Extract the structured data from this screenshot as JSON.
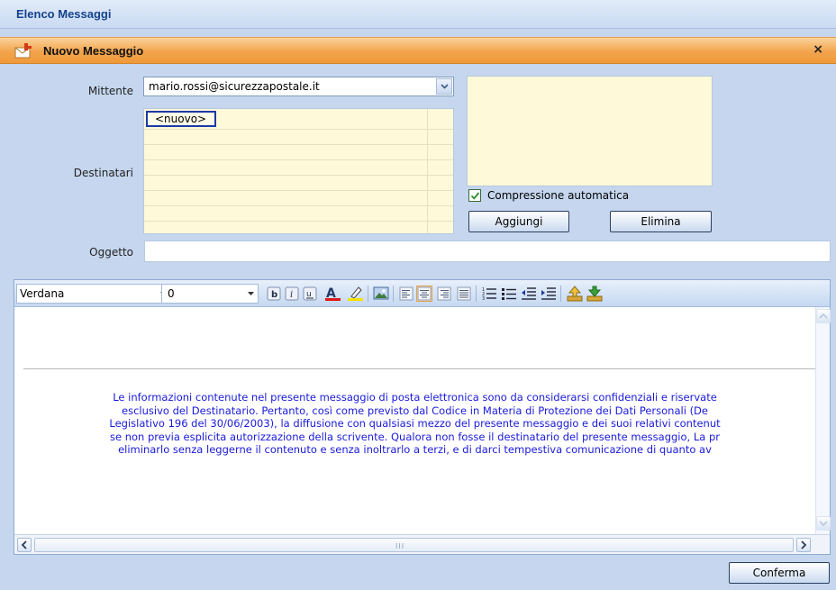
{
  "window": {
    "title": "Elenco Messaggi"
  },
  "dialog": {
    "title": "Nuovo Messaggio",
    "close_symbol": "×"
  },
  "form": {
    "sender_label": "Mittente",
    "sender_value": "mario.rossi@sicurezzapostale.it",
    "recipients_label": "Destinatari",
    "new_recipient": "<nuovo>",
    "compression_checked": true,
    "compression_label": "Compressione automatica",
    "add_button": "Aggiungi",
    "delete_button": "Elimina",
    "subject_label": "Oggetto",
    "subject_value": ""
  },
  "toolbar": {
    "font_family": "Verdana",
    "font_size": "0",
    "icons": [
      "bold-icon",
      "italic-icon",
      "underline-icon",
      "font-color-icon",
      "highlight-icon",
      "insert-image-icon",
      "align-left-icon",
      "align-center-icon",
      "align-right-icon",
      "justify-icon",
      "numbered-list-icon",
      "bullet-list-icon",
      "outdent-icon",
      "indent-icon",
      "upload-icon",
      "download-icon"
    ]
  },
  "editor": {
    "disclaimer_lines": [
      "Le informazioni contenute nel presente messaggio di posta elettronica sono da considerarsi confidenziali e riservate",
      "esclusivo del Destinatario. Pertanto, così come previsto dal Codice in Materia di Protezione dei Dati Personali (De",
      "Legislativo 196 del 30/06/2003), la diffusione con qualsiasi mezzo del presente messaggio e dei suoi relativi contenut",
      "se non previa esplicita autorizzazione della scrivente. Qualora non fosse il destinatario del presente messaggio, La pr",
      "eliminarlo senza leggerne il contenuto e senza inoltrarlo a terzi, e di darci tempestiva comunicazione di quanto av"
    ],
    "scroll_grip": "III"
  },
  "footer": {
    "confirm_button": "Conferma"
  },
  "colors": {
    "accent_orange": "#f2a44d",
    "title_blue": "#15428b",
    "disclaimer_blue": "#1a1adb",
    "field_yellow": "#fdf9d9"
  }
}
